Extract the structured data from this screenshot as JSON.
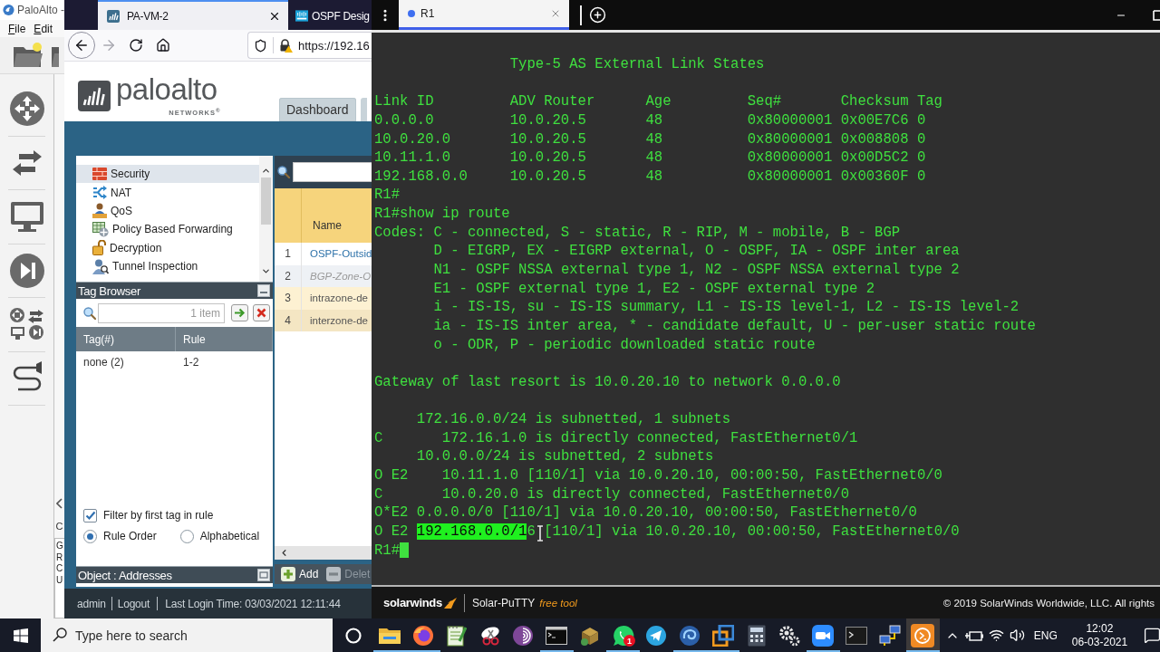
{
  "gns3_window": {
    "title": "PaloAlto -",
    "menu": [
      "File",
      "Edit"
    ],
    "console_panel": {
      "heading": "C",
      "lines": [
        "G",
        "R",
        "C",
        "U"
      ]
    }
  },
  "browser": {
    "tabs": [
      {
        "title": "PA-VM-2",
        "selected": true
      },
      {
        "title": "OSPF Desig",
        "selected": false
      }
    ],
    "url": "https://192.16"
  },
  "firewall_page": {
    "logo": {
      "name": "paloalto",
      "tagline": "NETWORKS$^{®}$"
    },
    "nav_tabs": [
      {
        "label": "Dashboard",
        "selected": false
      }
    ],
    "policy_types": [
      {
        "label": "Security",
        "kind": "firewall",
        "selected": true
      },
      {
        "label": "NAT",
        "kind": "nat",
        "selected": false
      },
      {
        "label": "QoS",
        "kind": "qos",
        "selected": false
      },
      {
        "label": "Policy Based Forwarding",
        "kind": "forwarding",
        "selected": false
      },
      {
        "label": "Decryption",
        "kind": "decryption",
        "selected": false
      },
      {
        "label": "Tunnel Inspection",
        "kind": "tunnel",
        "selected": false
      }
    ],
    "tag_browser": {
      "title": "Tag Browser",
      "filter_count": "1 item",
      "columns": [
        "Tag(#)",
        "Rule"
      ],
      "rows": [
        [
          "none (2)",
          "1-2"
        ]
      ],
      "filter_first_tag": {
        "label": "Filter by first tag in rule",
        "checked": true
      },
      "sort_options": [
        {
          "label": "Rule Order",
          "selected": true
        },
        {
          "label": "Alphabetical",
          "selected": false
        }
      ]
    },
    "object_panel": {
      "title": "Object : Addresses"
    },
    "rules_table": {
      "columns": [
        "Name"
      ],
      "rows": [
        {
          "number": "1",
          "name": "OSPF-Outsid",
          "kind": "custom",
          "disabled": false
        },
        {
          "number": "2",
          "name": "BGP-Zone-O",
          "kind": "custom",
          "disabled": true
        },
        {
          "number": "3",
          "name": "intrazone-de",
          "kind": "default",
          "disabled": false
        },
        {
          "number": "4",
          "name": "interzone-de",
          "kind": "default",
          "disabled": false
        }
      ]
    },
    "actions": [
      {
        "label": "Add",
        "kind": "add",
        "disabled": false
      },
      {
        "label": "Delet",
        "kind": "delete",
        "disabled": true
      }
    ],
    "footer": {
      "user": "admin",
      "logout": "Logout",
      "last_login": "Last Login Time: 03/03/2021 12:11:44"
    }
  },
  "terminal_app": {
    "tabs": [
      {
        "title": "R1",
        "selected": true
      }
    ],
    "lines": [
      {
        "kind": "text",
        "text": "                Type-5 AS External Link States"
      },
      {
        "kind": "blank"
      },
      {
        "kind": "text",
        "text": "Link ID         ADV Router      Age         Seq#       Checksum Tag"
      },
      {
        "kind": "text",
        "text": "0.0.0.0         10.0.20.5       48          0x80000001 0x00E7C6 0"
      },
      {
        "kind": "text",
        "text": "10.0.20.0       10.0.20.5       48          0x80000001 0x008808 0"
      },
      {
        "kind": "text",
        "text": "10.11.1.0       10.0.20.5       48          0x80000001 0x00D5C2 0"
      },
      {
        "kind": "text",
        "text": "192.168.0.0     10.0.20.5       48          0x80000001 0x00360F 0"
      },
      {
        "kind": "text",
        "text": "R1#"
      },
      {
        "kind": "text",
        "text": "R1#show ip route"
      },
      {
        "kind": "text",
        "text": "Codes: C - connected, S - static, R - RIP, M - mobile, B - BGP"
      },
      {
        "kind": "text",
        "text": "       D - EIGRP, EX - EIGRP external, O - OSPF, IA - OSPF inter area"
      },
      {
        "kind": "text",
        "text": "       N1 - OSPF NSSA external type 1, N2 - OSPF NSSA external type 2"
      },
      {
        "kind": "text",
        "text": "       E1 - OSPF external type 1, E2 - OSPF external type 2"
      },
      {
        "kind": "text",
        "text": "       i - IS-IS, su - IS-IS summary, L1 - IS-IS level-1, L2 - IS-IS level-2"
      },
      {
        "kind": "text",
        "text": "       ia - IS-IS inter area, * - candidate default, U - per-user static route"
      },
      {
        "kind": "text",
        "text": "       o - ODR, P - periodic downloaded static route"
      },
      {
        "kind": "blank"
      },
      {
        "kind": "text",
        "text": "Gateway of last resort is 10.0.20.10 to network 0.0.0.0"
      },
      {
        "kind": "blank"
      },
      {
        "kind": "text",
        "text": "     172.16.0.0/24 is subnetted, 1 subnets"
      },
      {
        "kind": "text",
        "text": "C       172.16.1.0 is directly connected, FastEthernet0/1"
      },
      {
        "kind": "text",
        "text": "     10.0.0.0/24 is subnetted, 2 subnets"
      },
      {
        "kind": "text",
        "text": "O E2    10.11.1.0 [110/1] via 10.0.20.10, 00:00:50, FastEthernet0/0"
      },
      {
        "kind": "text",
        "text": "C       10.0.20.0 is directly connected, FastEthernet0/0"
      },
      {
        "kind": "text",
        "text": "O*E2 0.0.0.0/0 [110/1] via 10.0.20.10, 00:00:50, FastEthernet0/0"
      },
      {
        "kind": "selection",
        "before": "O E2 ",
        "selected": "192.168.0.0/1",
        "after": "6 [110/1] via 10.0.20.10, 00:00:50, FastEthernet0/0"
      },
      {
        "kind": "prompt",
        "text": "R1#"
      }
    ],
    "footer": {
      "brand": "solarwinds",
      "product": "Solar-PuTTY",
      "note": "free tool",
      "copyright": "© 2019 SolarWinds Worldwide, LLC. All rights"
    }
  },
  "taskbar": {
    "search": {
      "placeholder": "Type here to search"
    },
    "apps": [
      {
        "kind": "folder",
        "open": true,
        "active": false
      },
      {
        "kind": "browser",
        "open": true,
        "active": false
      },
      {
        "kind": "notepad",
        "open": false,
        "active": false
      },
      {
        "kind": "scissors",
        "open": false,
        "active": false
      },
      {
        "kind": "onion",
        "open": false,
        "active": false
      },
      {
        "kind": "console",
        "open": true,
        "active": false
      },
      {
        "kind": "package",
        "open": false,
        "active": false
      },
      {
        "kind": "chat",
        "open": true,
        "active": false,
        "badge": "1"
      },
      {
        "kind": "plane",
        "open": false,
        "active": false
      },
      {
        "kind": "swirl",
        "open": true,
        "active": false
      },
      {
        "kind": "boxes",
        "open": true,
        "active": false
      },
      {
        "kind": "calculator",
        "open": false,
        "active": false
      },
      {
        "kind": "gears",
        "open": false,
        "active": false
      },
      {
        "kind": "video",
        "open": true,
        "active": false
      },
      {
        "kind": "terminal",
        "open": false,
        "active": false
      },
      {
        "kind": "network",
        "open": false,
        "active": false
      },
      {
        "kind": "prompt",
        "open": true,
        "active": true
      }
    ],
    "language": "ENG",
    "time": "12:02",
    "date": "06-03-2021"
  }
}
